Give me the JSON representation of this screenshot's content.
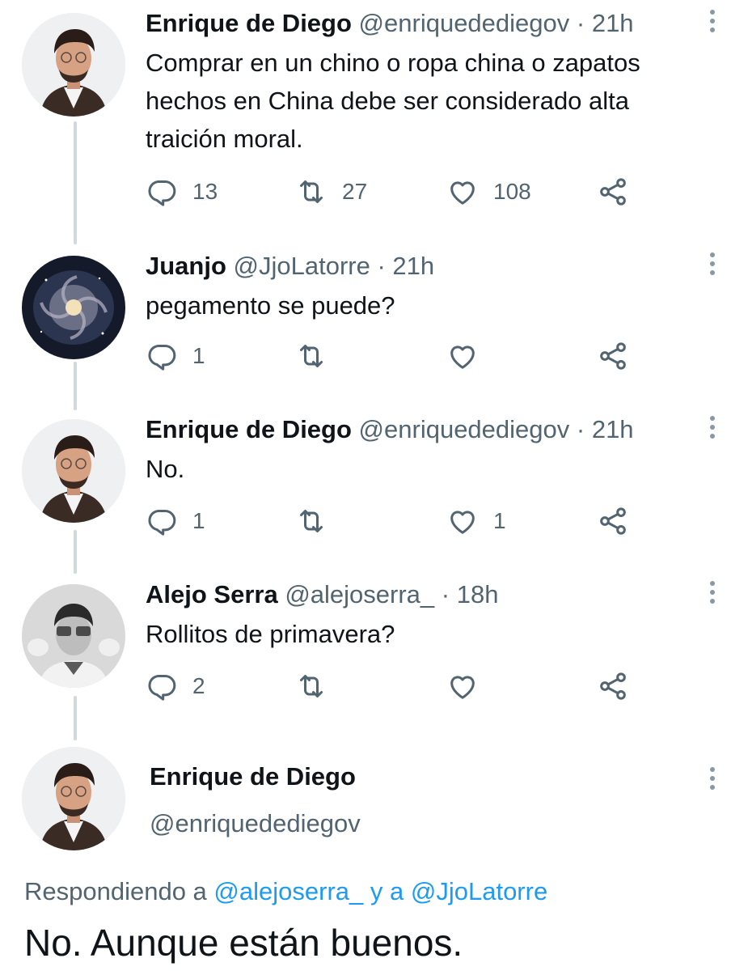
{
  "tweets": [
    {
      "name": "Enrique de Diego",
      "handle": "@enriquedediegov",
      "time": "· 21h",
      "avatar_icon": "portrait-man-glasses",
      "text": "Comprar en un chino o ropa china o zapatos hechos en China debe ser considerado alta traición moral.",
      "replies": "13",
      "retweets": "27",
      "likes": "108"
    },
    {
      "name": "Juanjo",
      "handle": "@JjoLatorre",
      "time": "· 21h",
      "avatar_icon": "galaxy-image",
      "text": "pegamento se puede?",
      "replies": "1",
      "retweets": "",
      "likes": ""
    },
    {
      "name": "Enrique de Diego",
      "handle": "@enriquedediegov",
      "time": "· 21h",
      "avatar_icon": "portrait-man-glasses",
      "text": "No.",
      "replies": "1",
      "retweets": "",
      "likes": "1"
    },
    {
      "name": "Alejo Serra",
      "handle": "@alejoserra_",
      "time": "· 18h",
      "avatar_icon": "bw-portrait-glasses-cats",
      "text": "Rollitos de primavera?",
      "replies": "2",
      "retweets": "",
      "likes": ""
    }
  ],
  "main_tweet": {
    "name": "Enrique de Diego",
    "handle": "@enriquedediegov",
    "avatar_icon": "portrait-man-glasses",
    "replying_prefix": "Respondiendo a",
    "replying_user1": "@alejoserra_",
    "replying_and": "y a",
    "replying_user2": "@JjoLatorre",
    "text": "No. Aunque están buenos."
  },
  "icons": {
    "reply": "reply-icon",
    "retweet": "retweet-icon",
    "like": "like-icon",
    "share": "share-icon",
    "more": "more-icon"
  },
  "colors": {
    "text": "#0f1419",
    "secondary": "#536471",
    "link": "#1d9bf0",
    "thread_line": "#cfd9de"
  }
}
